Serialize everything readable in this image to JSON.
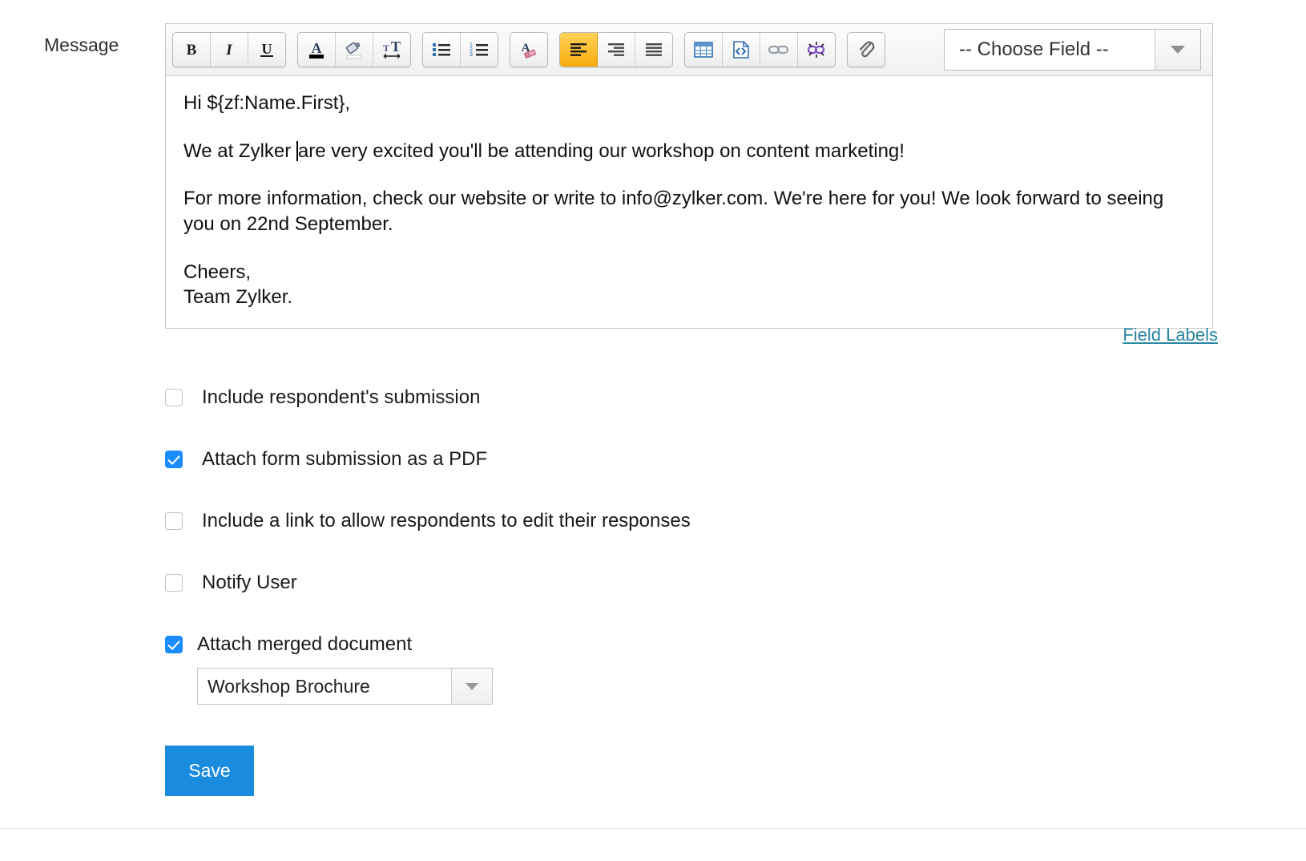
{
  "form": {
    "field_label": "Message"
  },
  "editor": {
    "toolbar": {
      "groups": [
        {
          "name": "text-style",
          "buttons": [
            {
              "icon": "bold-icon",
              "title": "Bold"
            },
            {
              "icon": "italic-icon",
              "title": "Italic"
            },
            {
              "icon": "underline-icon",
              "title": "Underline"
            }
          ]
        },
        {
          "name": "color-size",
          "buttons": [
            {
              "icon": "font-color-icon",
              "title": "Font Color"
            },
            {
              "icon": "background-color-icon",
              "title": "Background Color"
            },
            {
              "icon": "font-size-icon",
              "title": "Font Size"
            }
          ]
        },
        {
          "name": "lists",
          "buttons": [
            {
              "icon": "bulleted-list-icon",
              "title": "Bulleted List"
            },
            {
              "icon": "numbered-list-icon",
              "title": "Numbered List"
            }
          ]
        },
        {
          "name": "clear-format",
          "buttons": [
            {
              "icon": "clear-formatting-icon",
              "title": "Clear Formatting"
            }
          ]
        },
        {
          "name": "alignment",
          "buttons": [
            {
              "icon": "align-left-icon",
              "title": "Align Left",
              "active": true
            },
            {
              "icon": "align-right-icon",
              "title": "Align Right",
              "active": false
            },
            {
              "icon": "align-justify-icon",
              "title": "Justify",
              "active": false
            }
          ]
        },
        {
          "name": "insert",
          "buttons": [
            {
              "icon": "table-icon",
              "title": "Insert Table"
            },
            {
              "icon": "source-code-icon",
              "title": "Source Code"
            },
            {
              "icon": "link-icon",
              "title": "Insert Link"
            },
            {
              "icon": "unlink-icon",
              "title": "Remove Link"
            }
          ]
        },
        {
          "name": "attach",
          "buttons": [
            {
              "icon": "paperclip-icon",
              "title": "Attach File"
            }
          ]
        }
      ],
      "choose_field": {
        "selected": "-- Choose Field --"
      }
    },
    "body": {
      "line_greeting": "Hi ${zf:Name.First},",
      "line_intro_before_caret": "We at Zylker ",
      "line_intro_after_caret": "are very excited you'll be attending our workshop on content marketing!",
      "line_info": "For more information, check our website or write to info@zylker.com. We're here for you! We look forward to seeing you on 22nd September.",
      "line_signoff": "Cheers,",
      "line_team": "Team Zylker."
    }
  },
  "field_labels_link": "Field Labels",
  "options": [
    {
      "label": "Include respondent's submission",
      "checked": false
    },
    {
      "label": "Attach form submission as a PDF",
      "checked": true
    },
    {
      "label": "Include a link to allow respondents to edit their responses",
      "checked": false
    },
    {
      "label": "Notify User",
      "checked": false
    },
    {
      "label": "Attach merged document",
      "checked": true
    }
  ],
  "merged_document": {
    "selected": "Workshop Brochure"
  },
  "actions": {
    "save_label": "Save"
  },
  "colors": {
    "accent_blue": "#1a8ce0",
    "checkbox_blue": "#1a8cff",
    "link_teal": "#2886a0",
    "toolbar_active": "#f8ab0d"
  }
}
